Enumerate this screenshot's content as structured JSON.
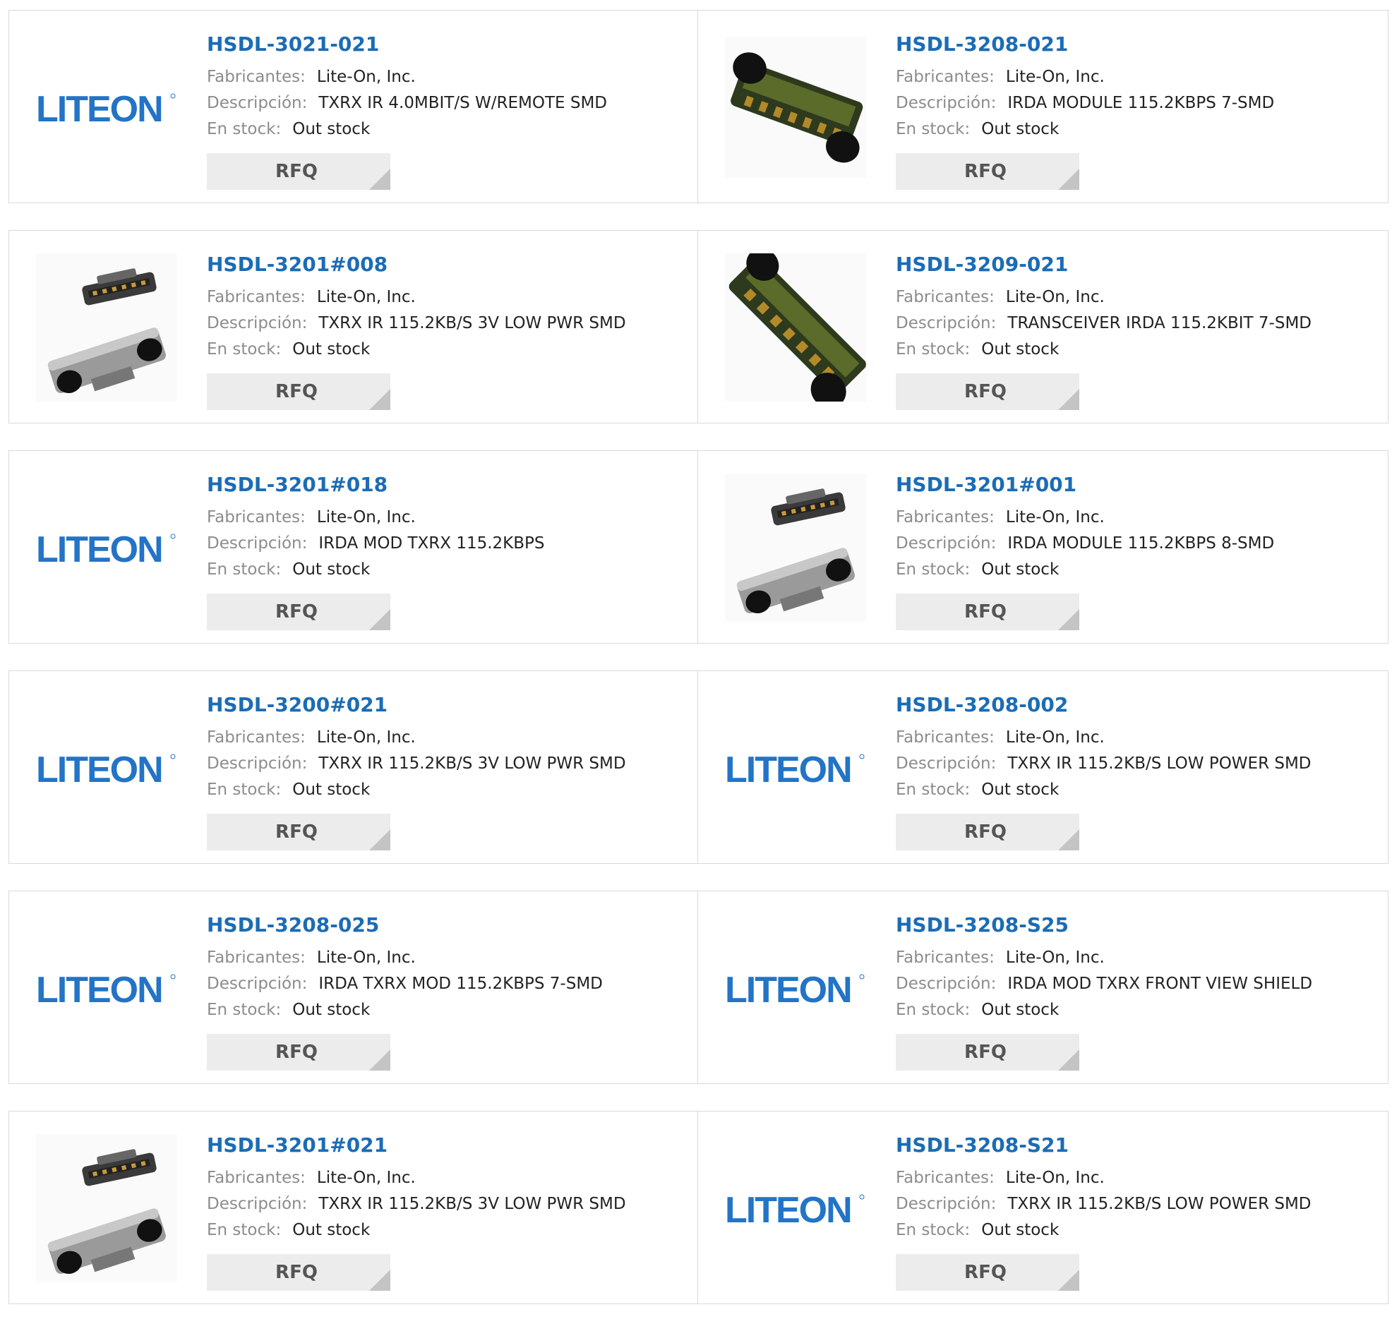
{
  "labels": {
    "manufacturer": "Fabricantes:",
    "description": "Descripción:",
    "stock": "En stock:",
    "rfq": "RFQ"
  },
  "logo_text": "LITEON",
  "colors": {
    "link": "#1b6cb5",
    "logo": "#2374c6",
    "label": "#8c8c8c",
    "button": "#ececec"
  },
  "products": [
    {
      "part": "HSDL-3021-021",
      "manufacturer": "Lite-On, Inc.",
      "description": "TXRX IR 4.0MBIT/S W/REMOTE SMD",
      "stock": "Out stock",
      "image": "liteon-logo"
    },
    {
      "part": "HSDL-3208-021",
      "manufacturer": "Lite-On, Inc.",
      "description": "IRDA MODULE 115.2KBPS 7-SMD",
      "stock": "Out stock",
      "image": "irda-module-photo"
    },
    {
      "part": "HSDL-3201#008",
      "manufacturer": "Lite-On, Inc.",
      "description": "TXRX IR 115.2KB/S 3V LOW PWR SMD",
      "stock": "Out stock",
      "image": "transceiver-photo"
    },
    {
      "part": "HSDL-3209-021",
      "manufacturer": "Lite-On, Inc.",
      "description": "TRANSCEIVER IRDA 115.2KBIT 7-SMD",
      "stock": "Out stock",
      "image": "irda-module-angled-photo"
    },
    {
      "part": "HSDL-3201#018",
      "manufacturer": "Lite-On, Inc.",
      "description": "IRDA MOD TXRX 115.2KBPS",
      "stock": "Out stock",
      "image": "liteon-logo"
    },
    {
      "part": "HSDL-3201#001",
      "manufacturer": "Lite-On, Inc.",
      "description": "IRDA MODULE 115.2KBPS 8-SMD",
      "stock": "Out stock",
      "image": "transceiver-photo"
    },
    {
      "part": "HSDL-3200#021",
      "manufacturer": "Lite-On, Inc.",
      "description": "TXRX IR 115.2KB/S 3V LOW PWR SMD",
      "stock": "Out stock",
      "image": "liteon-logo"
    },
    {
      "part": "HSDL-3208-002",
      "manufacturer": "Lite-On, Inc.",
      "description": "TXRX IR 115.2KB/S LOW POWER SMD",
      "stock": "Out stock",
      "image": "liteon-logo"
    },
    {
      "part": "HSDL-3208-025",
      "manufacturer": "Lite-On, Inc.",
      "description": "IRDA TXRX MOD 115.2KBPS 7-SMD",
      "stock": "Out stock",
      "image": "liteon-logo"
    },
    {
      "part": "HSDL-3208-S25",
      "manufacturer": "Lite-On, Inc.",
      "description": "IRDA MOD TXRX FRONT VIEW SHIELD",
      "stock": "Out stock",
      "image": "liteon-logo"
    },
    {
      "part": "HSDL-3201#021",
      "manufacturer": "Lite-On, Inc.",
      "description": "TXRX IR 115.2KB/S 3V LOW PWR SMD",
      "stock": "Out stock",
      "image": "transceiver-photo"
    },
    {
      "part": "HSDL-3208-S21",
      "manufacturer": "Lite-On, Inc.",
      "description": "TXRX IR 115.2KB/S LOW POWER SMD",
      "stock": "Out stock",
      "image": "liteon-logo"
    }
  ]
}
